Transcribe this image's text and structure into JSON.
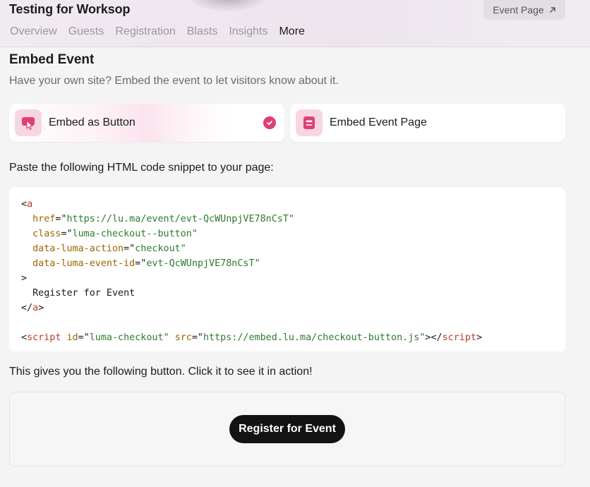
{
  "header": {
    "title": "Testing for Worksop",
    "event_page_label": "Event Page",
    "tabs": [
      {
        "label": "Overview",
        "active": false
      },
      {
        "label": "Guests",
        "active": false
      },
      {
        "label": "Registration",
        "active": false
      },
      {
        "label": "Blasts",
        "active": false
      },
      {
        "label": "Insights",
        "active": false
      },
      {
        "label": "More",
        "active": true
      }
    ]
  },
  "embed": {
    "title": "Embed Event",
    "subtitle": "Have your own site? Embed the event to let visitors know about it.",
    "options": [
      {
        "label": "Embed as Button",
        "selected": true
      },
      {
        "label": "Embed Event Page",
        "selected": false
      }
    ],
    "instruction": "Paste the following HTML code snippet to your page:",
    "code": {
      "href": "https://lu.ma/event/evt-QcWUnpjVE78nCsT",
      "class": "luma-checkout--button",
      "data_luma_action": "checkout",
      "data_luma_event_id": "evt-QcWUnpjVE78nCsT",
      "link_text": "Register for Event",
      "script_id": "luma-checkout",
      "script_src": "https://embed.lu.ma/checkout-button.js"
    },
    "preview_caption": "This gives you the following button. Click it to see it in action!",
    "preview_button_label": "Register for Event"
  },
  "colors": {
    "accent": "#de3f74",
    "icon_bg": "#f7d6e2",
    "button_dark": "#131313",
    "code_tag": "#c0392b",
    "code_attr": "#9a6500",
    "code_string": "#2d7a2d"
  },
  "icons": {
    "event_page": "arrow-up-right-icon",
    "button_option": "cursor-click-icon",
    "page_option": "page-embed-icon",
    "selected": "check-circle-icon"
  }
}
